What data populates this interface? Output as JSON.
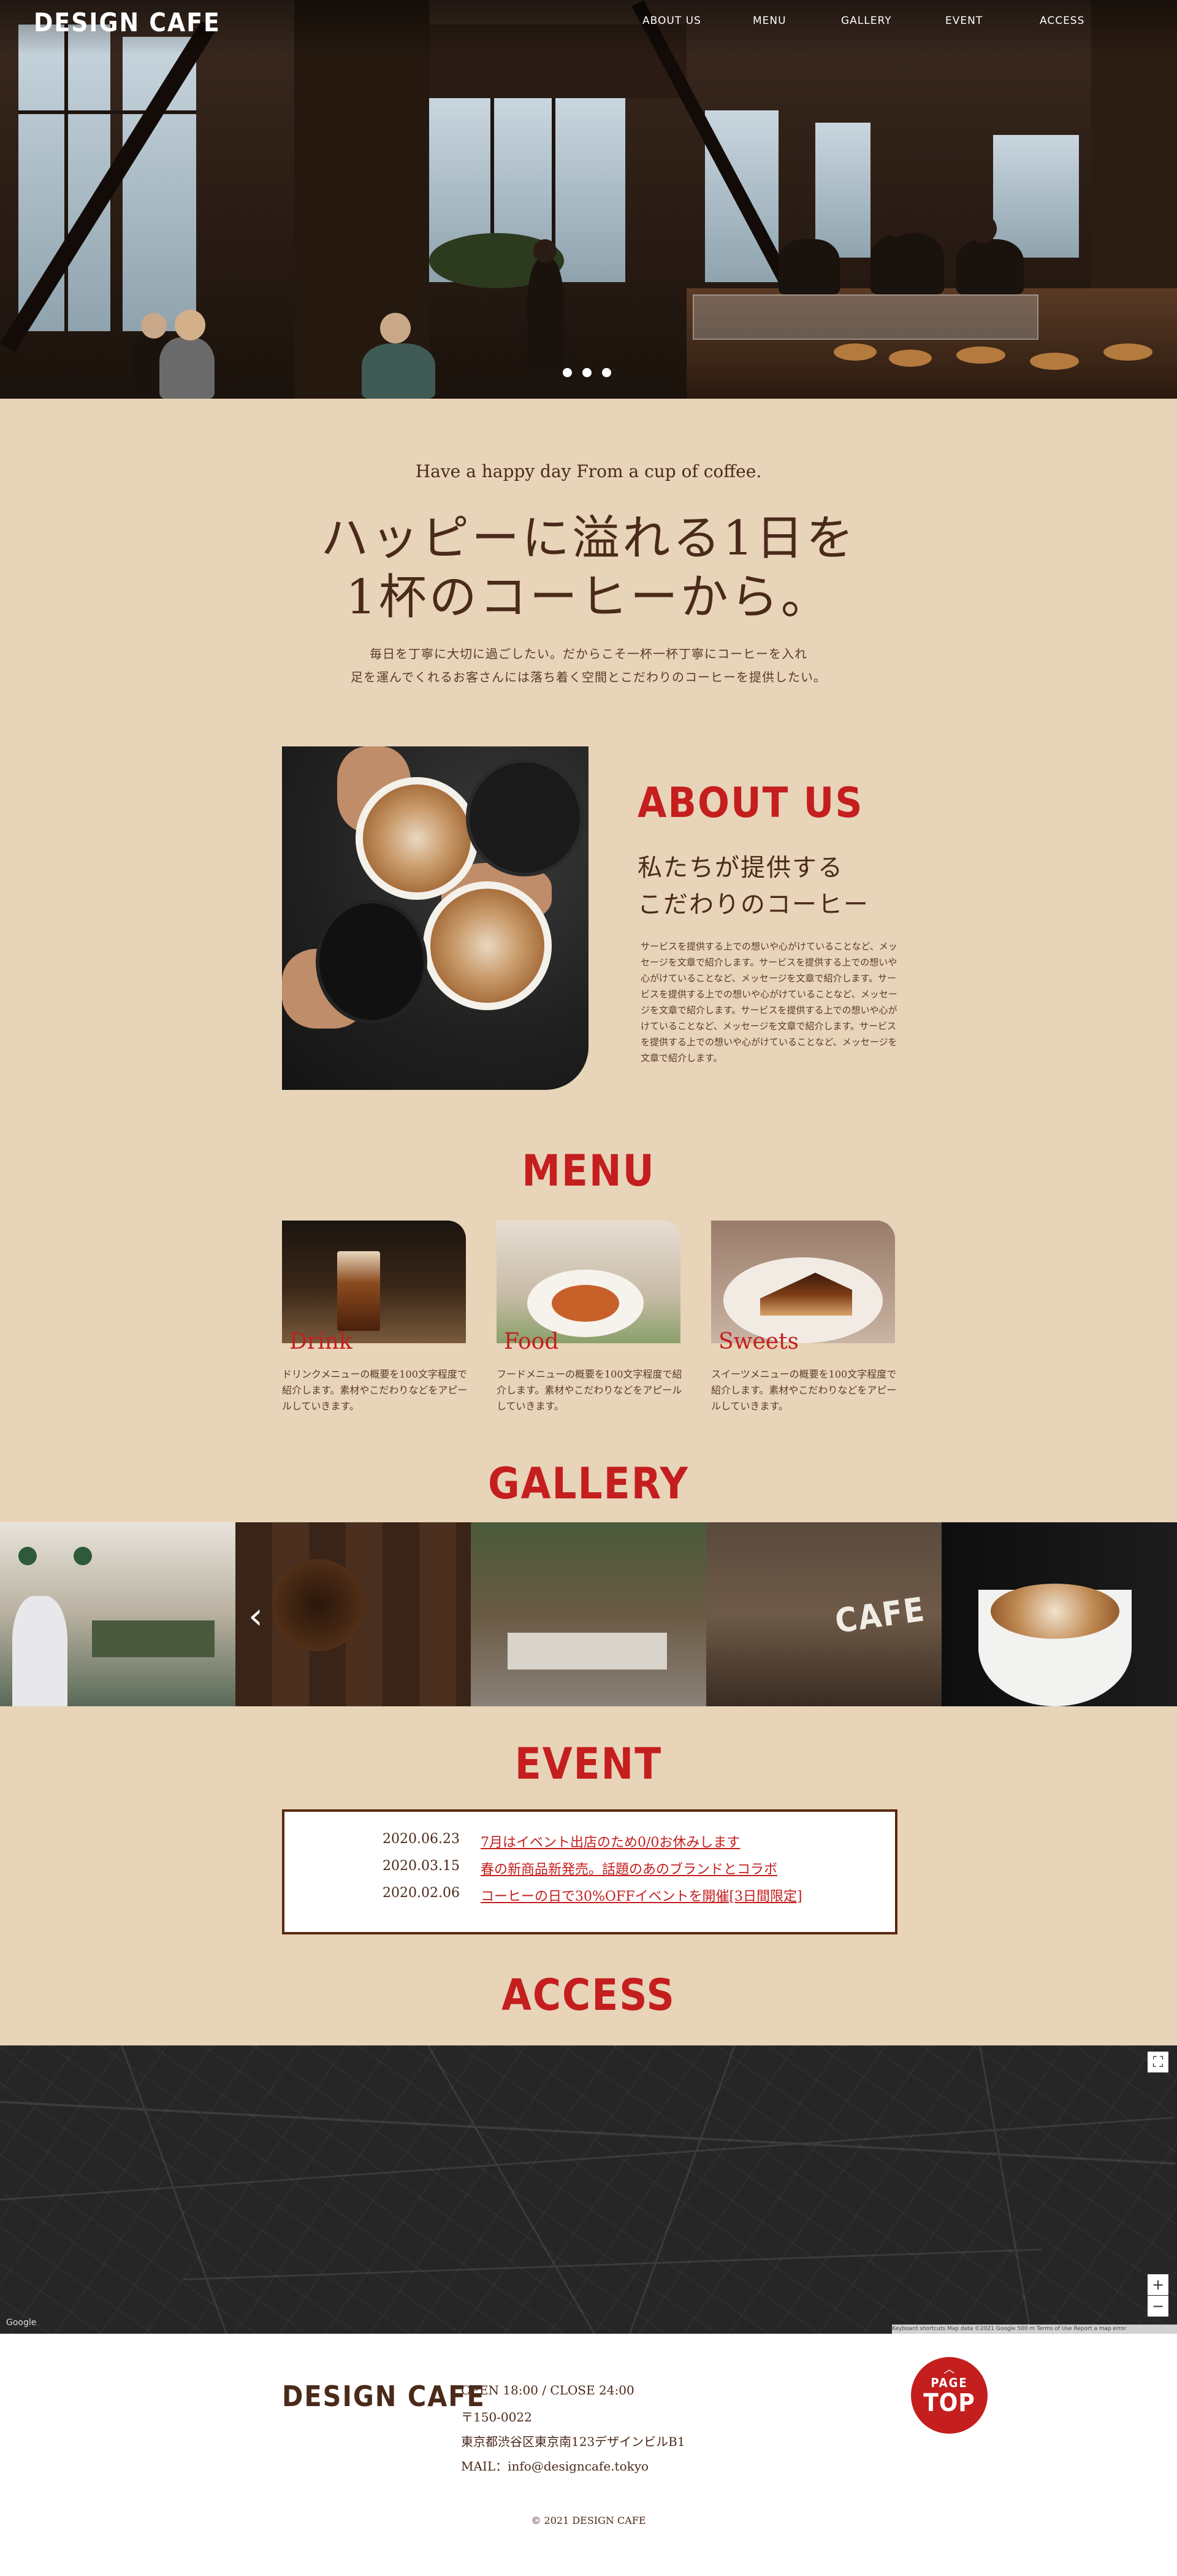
{
  "header": {
    "logo": "DESIGN CAFE",
    "nav": [
      "ABOUT US",
      "MENU",
      "GALLERY",
      "EVENT",
      "ACCESS"
    ]
  },
  "hero": {
    "slide_count": 3
  },
  "intro": {
    "tagline": "Have a happy day From a cup of coffee.",
    "headline_1": "ハッピーに溢れる1日を",
    "headline_2": "1杯のコーヒーから。",
    "text_1": "毎日を丁寧に大切に過ごしたい。だからこそ一杯一杯丁寧にコーヒーを入れ",
    "text_2": "足を運んでくれるお客さんには落ち着く空間とこだわりのコーヒーを提供したい。"
  },
  "about": {
    "title": "ABOUT US",
    "sub_1": "私たちが提供する",
    "sub_2": "こだわりのコーヒー",
    "body": "サービスを提供する上での想いや心がけていることなど、メッセージを文章で紹介します。サービスを提供する上での想いや心がけていることなど、メッセージを文章で紹介します。サービスを提供する上での想いや心がけていることなど、メッセージを文章で紹介します。サービスを提供する上での想いや心がけていることなど、メッセージを文章で紹介します。サービスを提供する上での想いや心がけていることなど、メッセージを文章で紹介します。"
  },
  "menu": {
    "title": "MENU",
    "items": [
      {
        "name": "Drink",
        "desc": "ドリンクメニューの概要を100文字程度で紹介します。素材やこだわりなどをアピールしていきます。"
      },
      {
        "name": "Food",
        "desc": "フードメニューの概要を100文字程度で紹介します。素材やこだわりなどをアピールしていきます。"
      },
      {
        "name": "Sweets",
        "desc": "スイーツメニューの概要を100文字程度で紹介します。素材やこだわりなどをアピールしていきます。"
      }
    ]
  },
  "gallery": {
    "title": "GALLERY",
    "prev_icon": "chevron-left-icon",
    "sign_text": "CAFE"
  },
  "event": {
    "title": "EVENT",
    "items": [
      {
        "date": "2020.06.23",
        "title": "7月はイベント出店のため0/0お休みします"
      },
      {
        "date": "2020.03.15",
        "title": "春の新商品新発売。話題のあのブランドとコラボ"
      },
      {
        "date": "2020.02.06",
        "title": "コーヒーの日で30%OFFイベントを開催[3日間限定]"
      }
    ]
  },
  "access": {
    "title": "ACCESS",
    "map_credit": "Google",
    "map_footer": "Keyboard shortcuts   Map data ©2021 Google   500 m   Terms of Use   Report a map error",
    "zoom_in": "+",
    "zoom_out": "−"
  },
  "footer": {
    "logo": "DESIGN CAFE",
    "hours": "OPEN 18:00 / CLOSE 24:00",
    "zip": "〒150-0022",
    "address": "東京都渋谷区東京南123デザインビルB1",
    "mail": "MAIL：info@designcafe.tokyo",
    "pagetop_1": "PAGE",
    "pagetop_2": "TOP",
    "copyright": "© 2021 DESIGN CAFE"
  },
  "colors": {
    "background": "#e8d4b8",
    "accent_red": "#c41e1e",
    "brown_text": "#4a2a1a",
    "footer_bg": "#ffffff"
  }
}
